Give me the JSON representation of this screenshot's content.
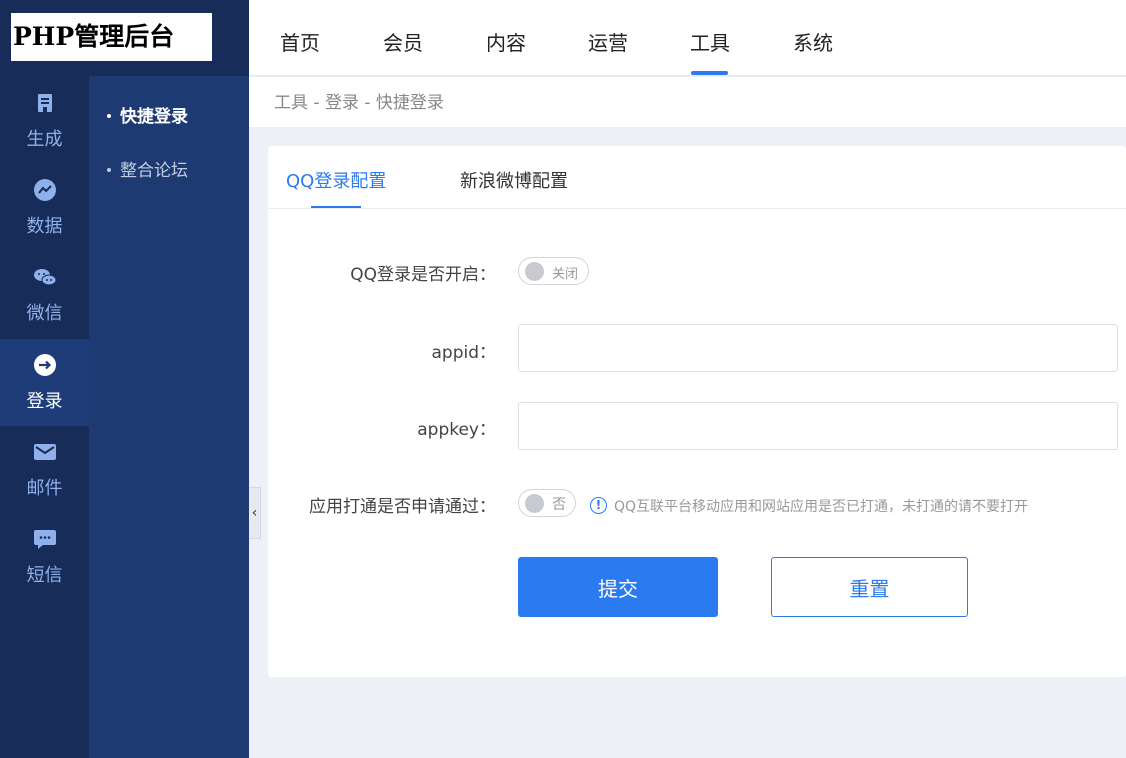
{
  "app": {
    "logo_text": "PHP管理后台"
  },
  "rail": {
    "items": [
      {
        "label": "生成",
        "icon": "building-icon"
      },
      {
        "label": "数据",
        "icon": "chart-icon"
      },
      {
        "label": "微信",
        "icon": "wechat-icon"
      },
      {
        "label": "登录",
        "icon": "arrow-right-icon",
        "active": true
      },
      {
        "label": "邮件",
        "icon": "mail-icon"
      },
      {
        "label": "短信",
        "icon": "message-icon"
      }
    ]
  },
  "subnav": {
    "items": [
      {
        "label": "快捷登录",
        "active": true
      },
      {
        "label": "整合论坛"
      }
    ]
  },
  "topnav": {
    "items": [
      "首页",
      "会员",
      "内容",
      "运营",
      "工具",
      "系统"
    ],
    "active": "工具"
  },
  "breadcrumb": "工具 - 登录 - 快捷登录",
  "tabs": [
    {
      "label": "QQ登录配置",
      "active": true
    },
    {
      "label": "新浪微博配置"
    }
  ],
  "form": {
    "qq_login_label": "QQ登录是否开启：",
    "qq_login_state": "关闭",
    "appid_label": "appid：",
    "appid_value": "",
    "appkey_label": "appkey：",
    "appkey_value": "",
    "app_connect_label": "应用打通是否申请通过：",
    "app_connect_state": "否",
    "hint_text": "QQ互联平台移动应用和网站应用是否已打通，未打通的请不要打开",
    "submit_label": "提交",
    "reset_label": "重置"
  },
  "colors": {
    "accent": "#2b7af0",
    "rail_bg": "#172c58",
    "subnav_bg": "#1e3a72"
  }
}
